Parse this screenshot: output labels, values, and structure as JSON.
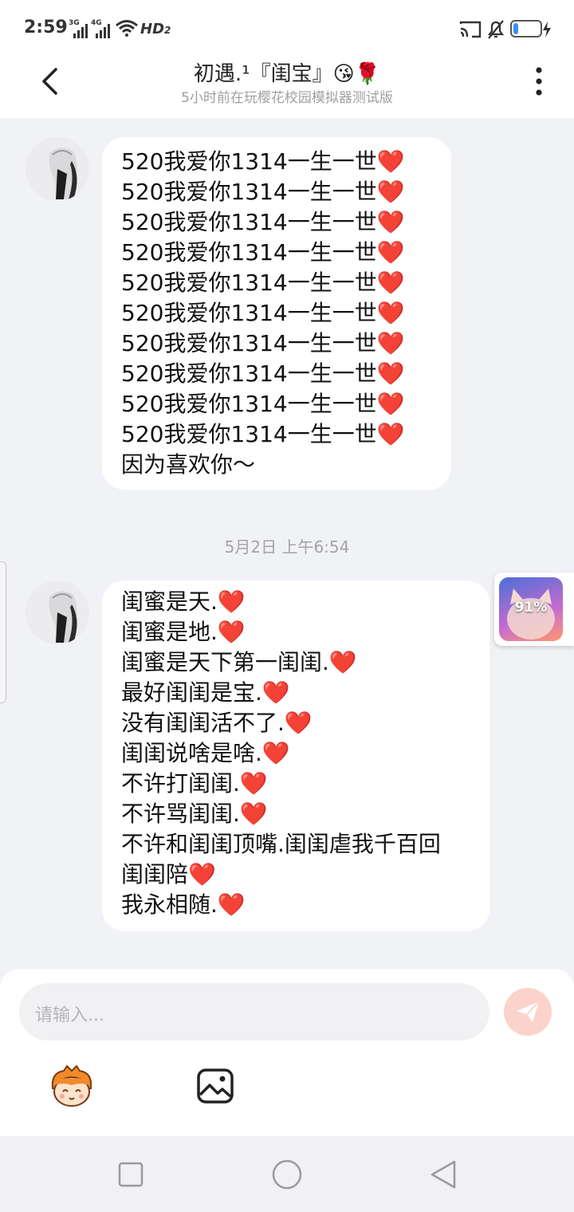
{
  "status_bar": {
    "time": "2:59",
    "network_1": "3G",
    "network_2": "4G",
    "wifi_badge": "HD",
    "wifi_badge_num": "2",
    "battery_level": 0.2
  },
  "header": {
    "title": "初遇.¹『闺宝』😘🌹",
    "subtitle": "5小时前在玩樱花校园模拟器测试版"
  },
  "messages": [
    {
      "lines": [
        "520我爱你1314一生一世❤️",
        "520我爱你1314一生一世❤️",
        "520我爱你1314一生一世❤️",
        "520我爱你1314一生一世❤️",
        "520我爱你1314一生一世❤️",
        "520我爱你1314一生一世❤️",
        "520我爱你1314一生一世❤️",
        "520我爱你1314一生一世❤️",
        "520我爱你1314一生一世❤️",
        "520我爱你1314一生一世❤️",
        "因为喜欢你～"
      ]
    },
    {
      "lines": [
        "闺蜜是天.❤️",
        "闺蜜是地.❤️",
        "闺蜜是天下第一闺闺.❤️",
        "最好闺闺是宝.❤️",
        "没有闺闺活不了.❤️",
        "闺闺说啥是啥.❤️",
        "不许打闺闺.❤️",
        "不许骂闺闺.❤️",
        "不许和闺闺顶嘴.闺闺虐我千百回",
        "闺闺陪❤️",
        "我永相随.❤️"
      ]
    }
  ],
  "timestamp": "5月2日 上午6:54",
  "floating_widget": {
    "progress_text": "91%"
  },
  "input": {
    "placeholder": "请输入..."
  },
  "icons": {
    "back": "back-arrow-icon",
    "more": "more-vertical-icon",
    "send": "send-icon",
    "sticker": "sticker-face-icon",
    "image": "image-icon",
    "nav_recent": "square-icon",
    "nav_home": "circle-icon",
    "nav_back": "triangle-back-icon"
  },
  "colors": {
    "accent_send": "#fbd3cb",
    "bubble_bg": "#ffffff",
    "chat_bg": "#f1f2f6"
  }
}
